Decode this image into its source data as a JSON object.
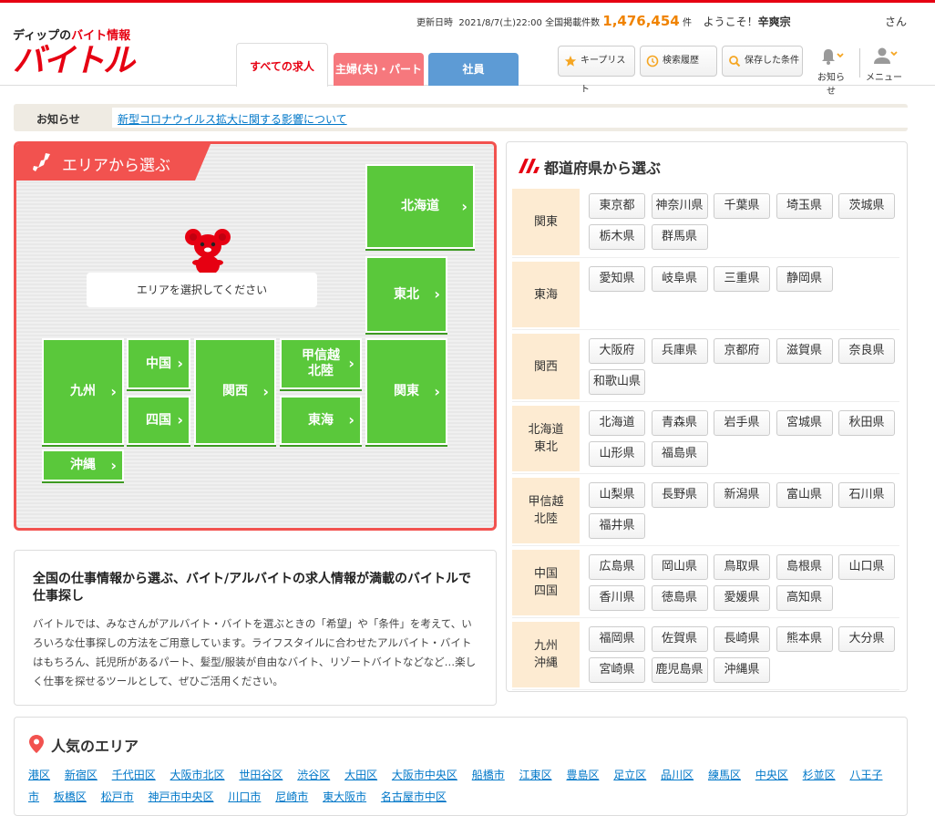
{
  "header": {
    "logo_tag_pre": "ディップの",
    "logo_tag_red": "バイト情報",
    "logo_text": "バイトル",
    "updated_label": "更新日時",
    "updated_value": "2021/8/7(土)22:00",
    "total_label": "全国掲載件数",
    "total_count": "1,476,454",
    "total_unit": "件",
    "welcome": "ようこそ！",
    "user_name": "辛爽宗",
    "honorific": "さん",
    "tabs": [
      "すべての求人",
      "主婦(夫)・パート",
      "社員"
    ],
    "buttons": [
      "キープリスト",
      "検索履歴",
      "保存した条件"
    ],
    "notify_label": "お知らせ",
    "menu_label": "メニュー"
  },
  "notice": {
    "label": "お知らせ",
    "link": "新型コロナウイルス拡大に関する影響について"
  },
  "area": {
    "title": "エリアから選ぶ",
    "prompt": "エリアを選択してください",
    "regions": [
      "北海道",
      "東北",
      "九州",
      "中国",
      "関西",
      "甲信越\n北陸",
      "関東",
      "四国",
      "東海",
      "沖縄"
    ]
  },
  "prefectures": {
    "title": "都道府県から選ぶ",
    "groups": [
      {
        "name": "関東",
        "items": [
          "東京都",
          "神奈川県",
          "千葉県",
          "埼玉県",
          "茨城県",
          "栃木県",
          "群馬県"
        ]
      },
      {
        "name": "東海",
        "items": [
          "愛知県",
          "岐阜県",
          "三重県",
          "静岡県"
        ]
      },
      {
        "name": "関西",
        "items": [
          "大阪府",
          "兵庫県",
          "京都府",
          "滋賀県",
          "奈良県",
          "和歌山県"
        ]
      },
      {
        "name": "北海道\n東北",
        "items": [
          "北海道",
          "青森県",
          "岩手県",
          "宮城県",
          "秋田県",
          "山形県",
          "福島県"
        ]
      },
      {
        "name": "甲信越\n北陸",
        "items": [
          "山梨県",
          "長野県",
          "新潟県",
          "富山県",
          "石川県",
          "福井県"
        ]
      },
      {
        "name": "中国\n四国",
        "items": [
          "広島県",
          "岡山県",
          "鳥取県",
          "島根県",
          "山口県",
          "香川県",
          "徳島県",
          "愛媛県",
          "高知県"
        ]
      },
      {
        "name": "九州\n沖縄",
        "items": [
          "福岡県",
          "佐賀県",
          "長崎県",
          "熊本県",
          "大分県",
          "宮崎県",
          "鹿児島県",
          "沖縄県"
        ]
      }
    ]
  },
  "description": {
    "heading": "全国の仕事情報から選ぶ、バイト/アルバイトの求人情報が満載のバイトルで仕事探し",
    "body": "バイトルでは、みなさんがアルバイト・バイトを選ぶときの「希望」や「条件」を考えて、いろいろな仕事探しの方法をご用意しています。ライフスタイルに合わせたアルバイト・バイトはもちろん、託児所があるパート、髪型/服装が自由なバイト、リゾートバイトなどなど…楽しく仕事を探せるツールとして、ぜひご活用ください。"
  },
  "popular": {
    "title": "人気のエリア",
    "links": [
      "港区",
      "新宿区",
      "千代田区",
      "大阪市北区",
      "世田谷区",
      "渋谷区",
      "大田区",
      "大阪市中央区",
      "船橋市",
      "江東区",
      "豊島区",
      "足立区",
      "品川区",
      "練馬区",
      "中央区",
      "杉並区",
      "八王子市",
      "板橋区",
      "松戸市",
      "神戸市中央区",
      "川口市",
      "尼崎市",
      "東大阪市",
      "名古屋市中区"
    ]
  },
  "colors": {
    "brand_red": "#e60012",
    "region_green": "#5ac83b",
    "link_blue": "#0077c8",
    "count_orange": "#f08300"
  }
}
